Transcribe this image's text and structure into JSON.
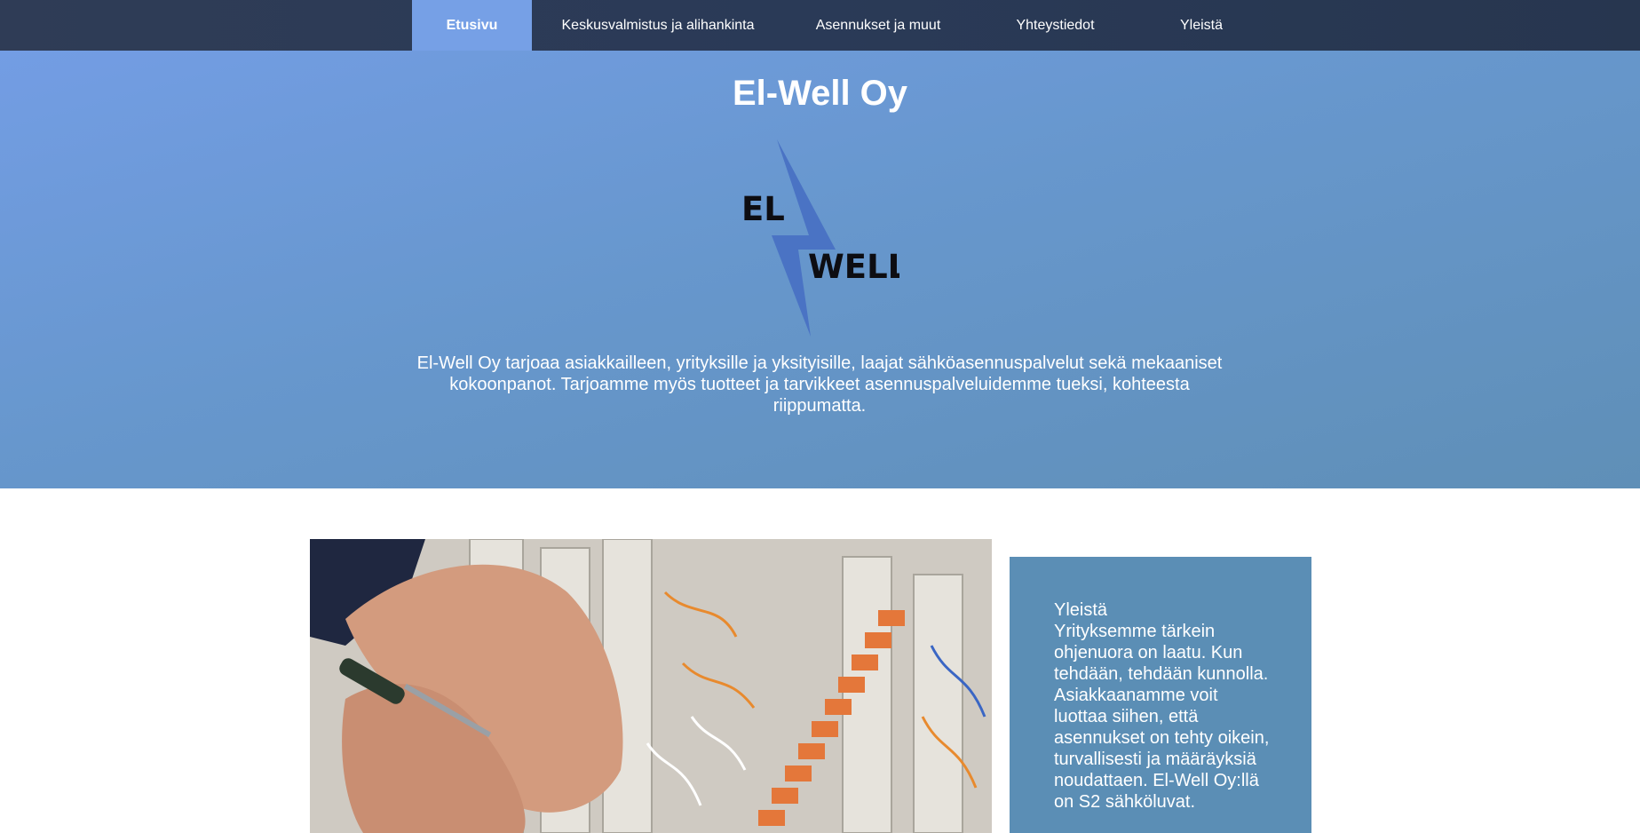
{
  "nav": {
    "items": [
      {
        "label": "Etusivu",
        "active": true
      },
      {
        "label": "Keskusvalmistus ja alihankinta"
      },
      {
        "label": "Asennukset ja muut"
      },
      {
        "label": "Yhteystiedot"
      },
      {
        "label": "Yleistä"
      }
    ]
  },
  "hero": {
    "title": "El-Well Oy",
    "logo": {
      "top_text": "EL",
      "bottom_text": "WELL"
    },
    "intro": "El-Well Oy tarjoaa asiakkailleen, yrityksille ja yksityisille, laajat sähköasennuspalvelut sekä mekaaniset kokoonpanot. Tarjoamme myös tuotteet ja tarvikkeet asennuspalveluidemme tueksi, kohteesta riippumatta."
  },
  "card": {
    "heading": "Yleistä",
    "body": "Yrityksemme tärkein ohjenuora on laatu. Kun tehdään, tehdään kunnolla. Asiakkaanamme voit luottaa siihen, että asennukset on tehty oikein, turvallisesti ja määräyksiä noudattaen. El-Well Oy:llä on S2 sähköluvat."
  },
  "colors": {
    "nav_bg": "#2a3a57",
    "nav_active": "#76a0e6",
    "hero_top": "#739de4",
    "hero_bottom": "#5f8fb7",
    "card_bg": "#5b8eb5",
    "logo_bolt": "#4a73c4"
  }
}
